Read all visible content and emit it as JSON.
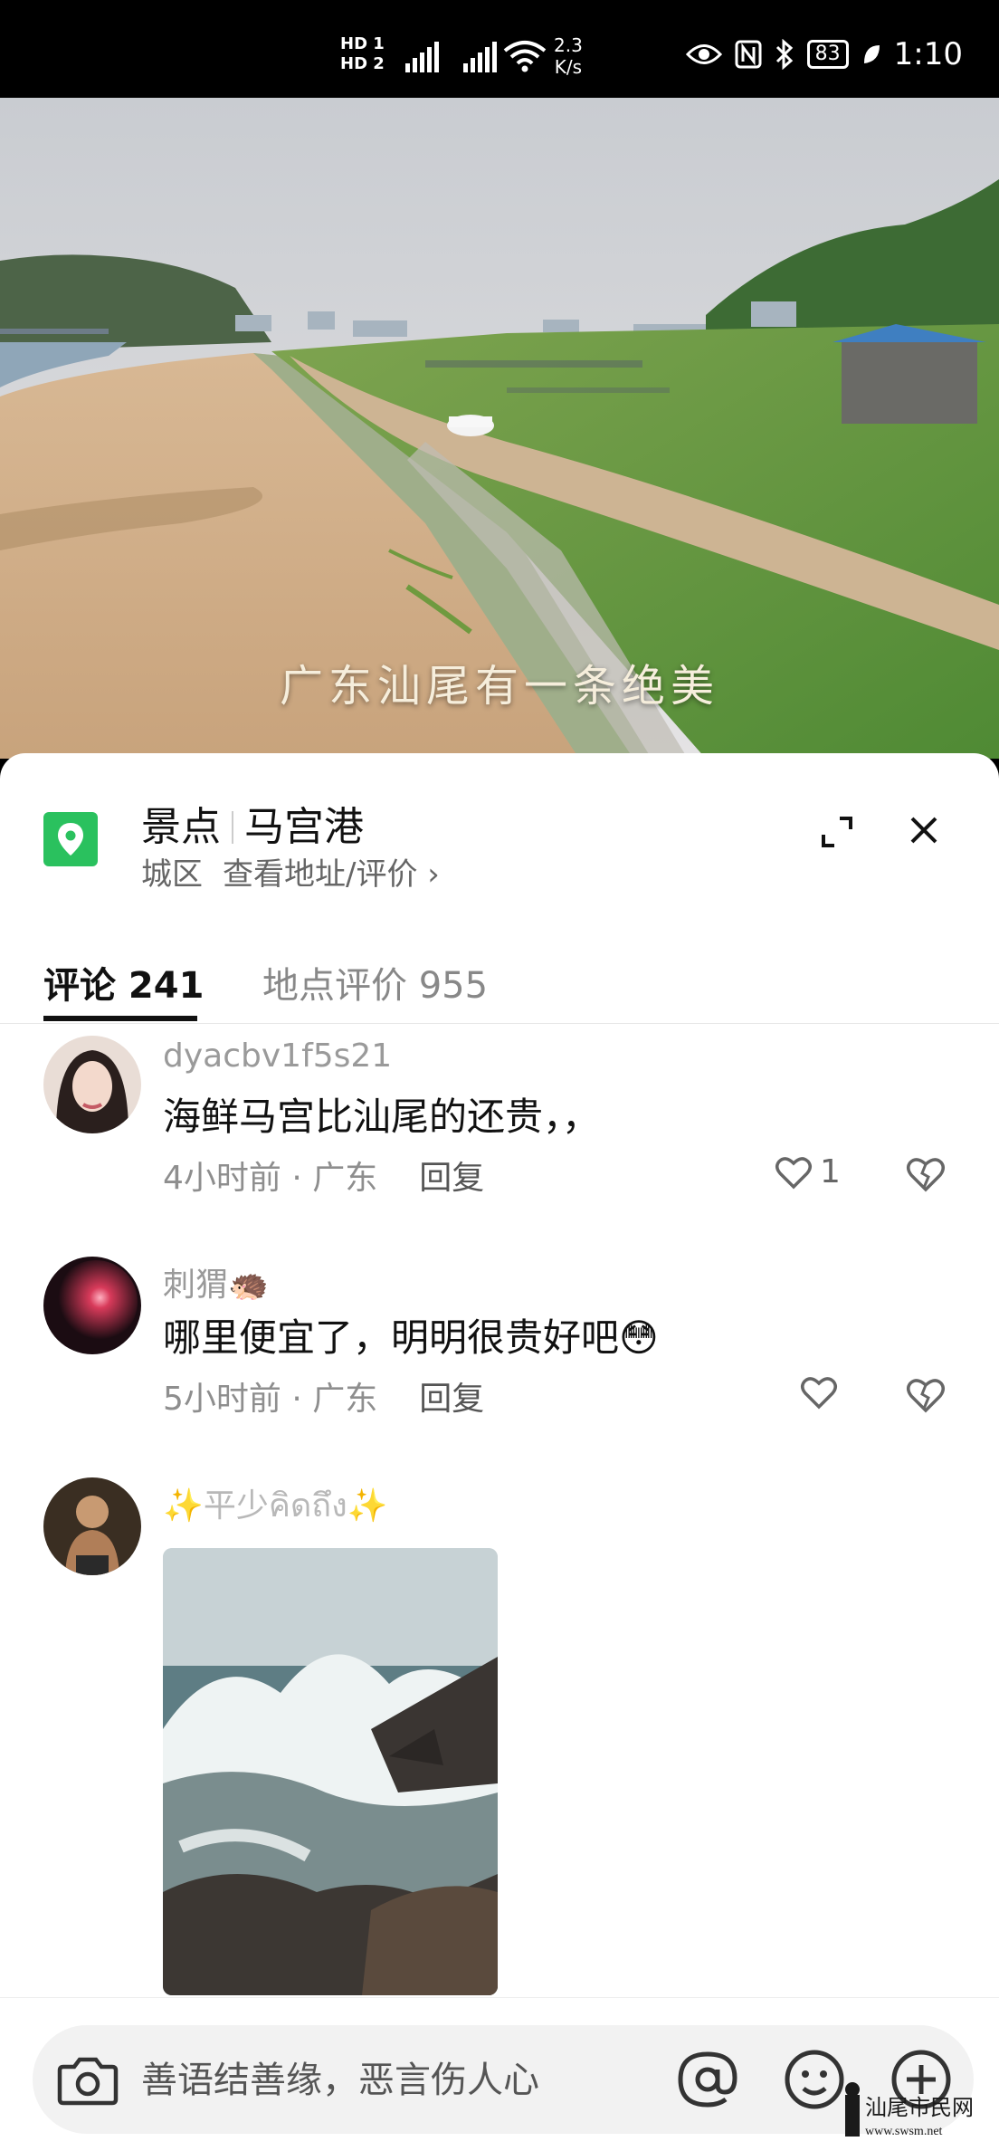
{
  "status_bar": {
    "hd1": "HD 1",
    "hd2": "HD 2",
    "net_speed_value": "2.3",
    "net_speed_unit": "K/s",
    "battery": "83",
    "time": "1:10"
  },
  "video": {
    "caption": "广东汕尾有一条绝美"
  },
  "location": {
    "category": "景点",
    "name": "马宫港",
    "district": "城区",
    "view_link": "查看地址/评价 ›"
  },
  "tabs": [
    {
      "label": "评论 241",
      "active": true
    },
    {
      "label": "地点评价 955",
      "active": false
    }
  ],
  "comments": [
    {
      "user": "dyacbv1f5s21",
      "text": "海鲜马宫比汕尾的还贵，，",
      "time": "4小时前",
      "region": "广东",
      "reply": "回复",
      "likes": "1"
    },
    {
      "user": "刺猬🦔",
      "text": "哪里便宜了，明明很贵好吧😳",
      "time": "5小时前",
      "region": "广东",
      "reply": "回复",
      "likes": ""
    },
    {
      "user": "✨平少คิดถึง✨"
    }
  ],
  "meta_sep": " · ",
  "input": {
    "placeholder": "善语结善缘，恶言伤人心"
  },
  "watermark": {
    "text": "汕尾市民网",
    "url": "www.swsm.net"
  },
  "colors": {
    "accent_green": "#2ac15e",
    "text_primary": "#111111",
    "text_secondary": "#8e8e8e"
  }
}
